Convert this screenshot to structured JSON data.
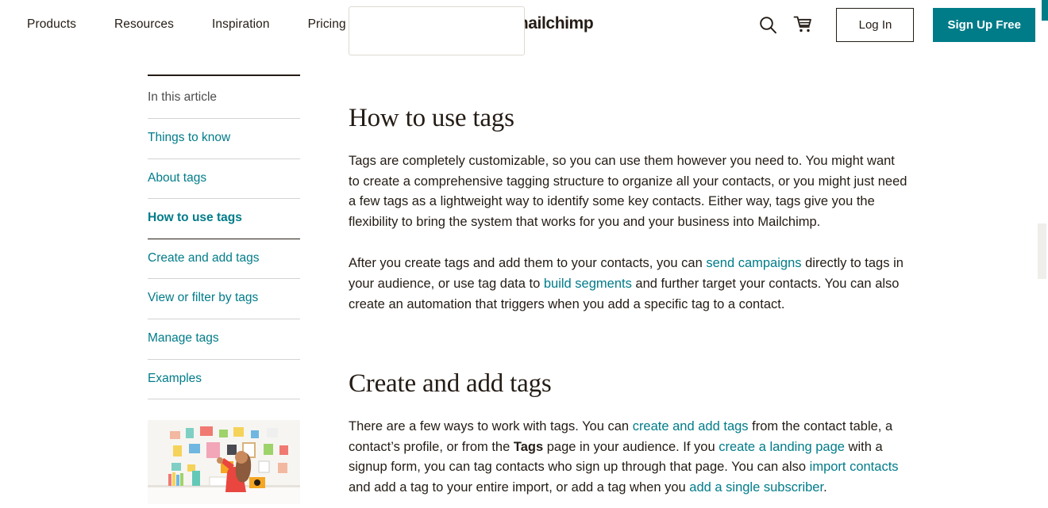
{
  "header": {
    "nav": [
      {
        "label": "Products"
      },
      {
        "label": "Resources"
      },
      {
        "label": "Inspiration"
      },
      {
        "label": "Pricing"
      }
    ],
    "logo_word": "mailchimp",
    "search_icon": "search-icon",
    "cart_icon": "cart-icon",
    "login_label": "Log In",
    "signup_label": "Sign Up Free",
    "accent_color": "#007c89"
  },
  "sidebar": {
    "toc_label": "In this article",
    "items": [
      {
        "label": "Things to know",
        "active": false
      },
      {
        "label": "About tags",
        "active": false
      },
      {
        "label": "How to use tags",
        "active": true
      },
      {
        "label": "Create and add tags",
        "active": false
      },
      {
        "label": "View or filter by tags",
        "active": false
      },
      {
        "label": "Manage tags",
        "active": false
      },
      {
        "label": "Examples",
        "active": false
      }
    ],
    "promo_image_alt": "person at white desk arranging colorful notes and art on a wall"
  },
  "content": {
    "sections": [
      {
        "heading": "How to use tags",
        "paragraphs": [
          {
            "runs": [
              {
                "text": "Tags are completely customizable, so you can use them however you need to. You might want to create a comprehensive tagging structure to organize all your contacts, or you might just need a few tags as a lightweight way to identify some key contacts. Either way, tags give you the flexibility to bring the system that works for you and your business into Mailchimp.",
                "type": "text"
              }
            ]
          },
          {
            "runs": [
              {
                "text": "After you create tags and add them to your contacts, you can ",
                "type": "text"
              },
              {
                "text": "send campaigns",
                "type": "link"
              },
              {
                "text": " directly to tags in your audience, or use tag data to ",
                "type": "text"
              },
              {
                "text": "build segments",
                "type": "link"
              },
              {
                "text": " and further target your contacts. You can also create an automation that triggers when you add a specific tag to a contact.",
                "type": "text"
              }
            ]
          }
        ]
      },
      {
        "heading": "Create and add tags",
        "paragraphs": [
          {
            "runs": [
              {
                "text": "There are a few ways to work with tags. You can ",
                "type": "text"
              },
              {
                "text": "create and add tags",
                "type": "link"
              },
              {
                "text": " from the contact table, a contact’s profile, or from the ",
                "type": "text"
              },
              {
                "text": "Tags",
                "type": "bold"
              },
              {
                "text": " page in your audience. If you ",
                "type": "text"
              },
              {
                "text": "create a landing page",
                "type": "link"
              },
              {
                "text": " with a signup form, you can tag contacts who sign up through that page. You can also ",
                "type": "text"
              },
              {
                "text": "import contacts",
                "type": "link"
              },
              {
                "text": " and add a tag to your entire import, or add a tag when you ",
                "type": "text"
              },
              {
                "text": "add a single subscriber",
                "type": "link"
              },
              {
                "text": ".",
                "type": "text"
              }
            ]
          }
        ]
      }
    ]
  },
  "scrollbar": {
    "thumb_color": "#efeeea"
  }
}
